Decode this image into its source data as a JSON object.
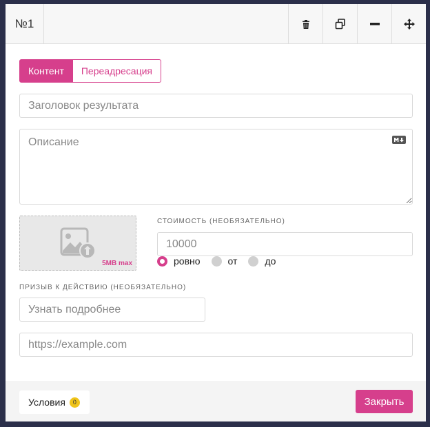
{
  "header": {
    "number": "№1",
    "icons": [
      "trash-icon",
      "copy-icon",
      "minimize-icon",
      "move-icon"
    ]
  },
  "tabs": [
    {
      "label": "Контент",
      "active": true
    },
    {
      "label": "Переадресация",
      "active": false
    }
  ],
  "title_field": {
    "placeholder": "Заголовок результата",
    "value": ""
  },
  "description_field": {
    "placeholder": "Описание",
    "value": ""
  },
  "upload": {
    "size_limit": "5MB max"
  },
  "price": {
    "label": "Стоимость (необязательно)",
    "value": "",
    "placeholder": "10000",
    "options": [
      {
        "label": "ровно",
        "checked": true
      },
      {
        "label": "от",
        "checked": false
      },
      {
        "label": "до",
        "checked": false
      }
    ]
  },
  "cta": {
    "label": "Призыв к действию (необязательно)",
    "placeholder": "Узнать подробнее",
    "value": ""
  },
  "url_field": {
    "placeholder": "https://example.com",
    "value": ""
  },
  "footer": {
    "conditions_label": "Условия",
    "conditions_count": "0",
    "close_label": "Закрыть"
  },
  "colors": {
    "accent": "#d63f8c",
    "badge": "#f0c419",
    "background": "#2b2f4a"
  }
}
